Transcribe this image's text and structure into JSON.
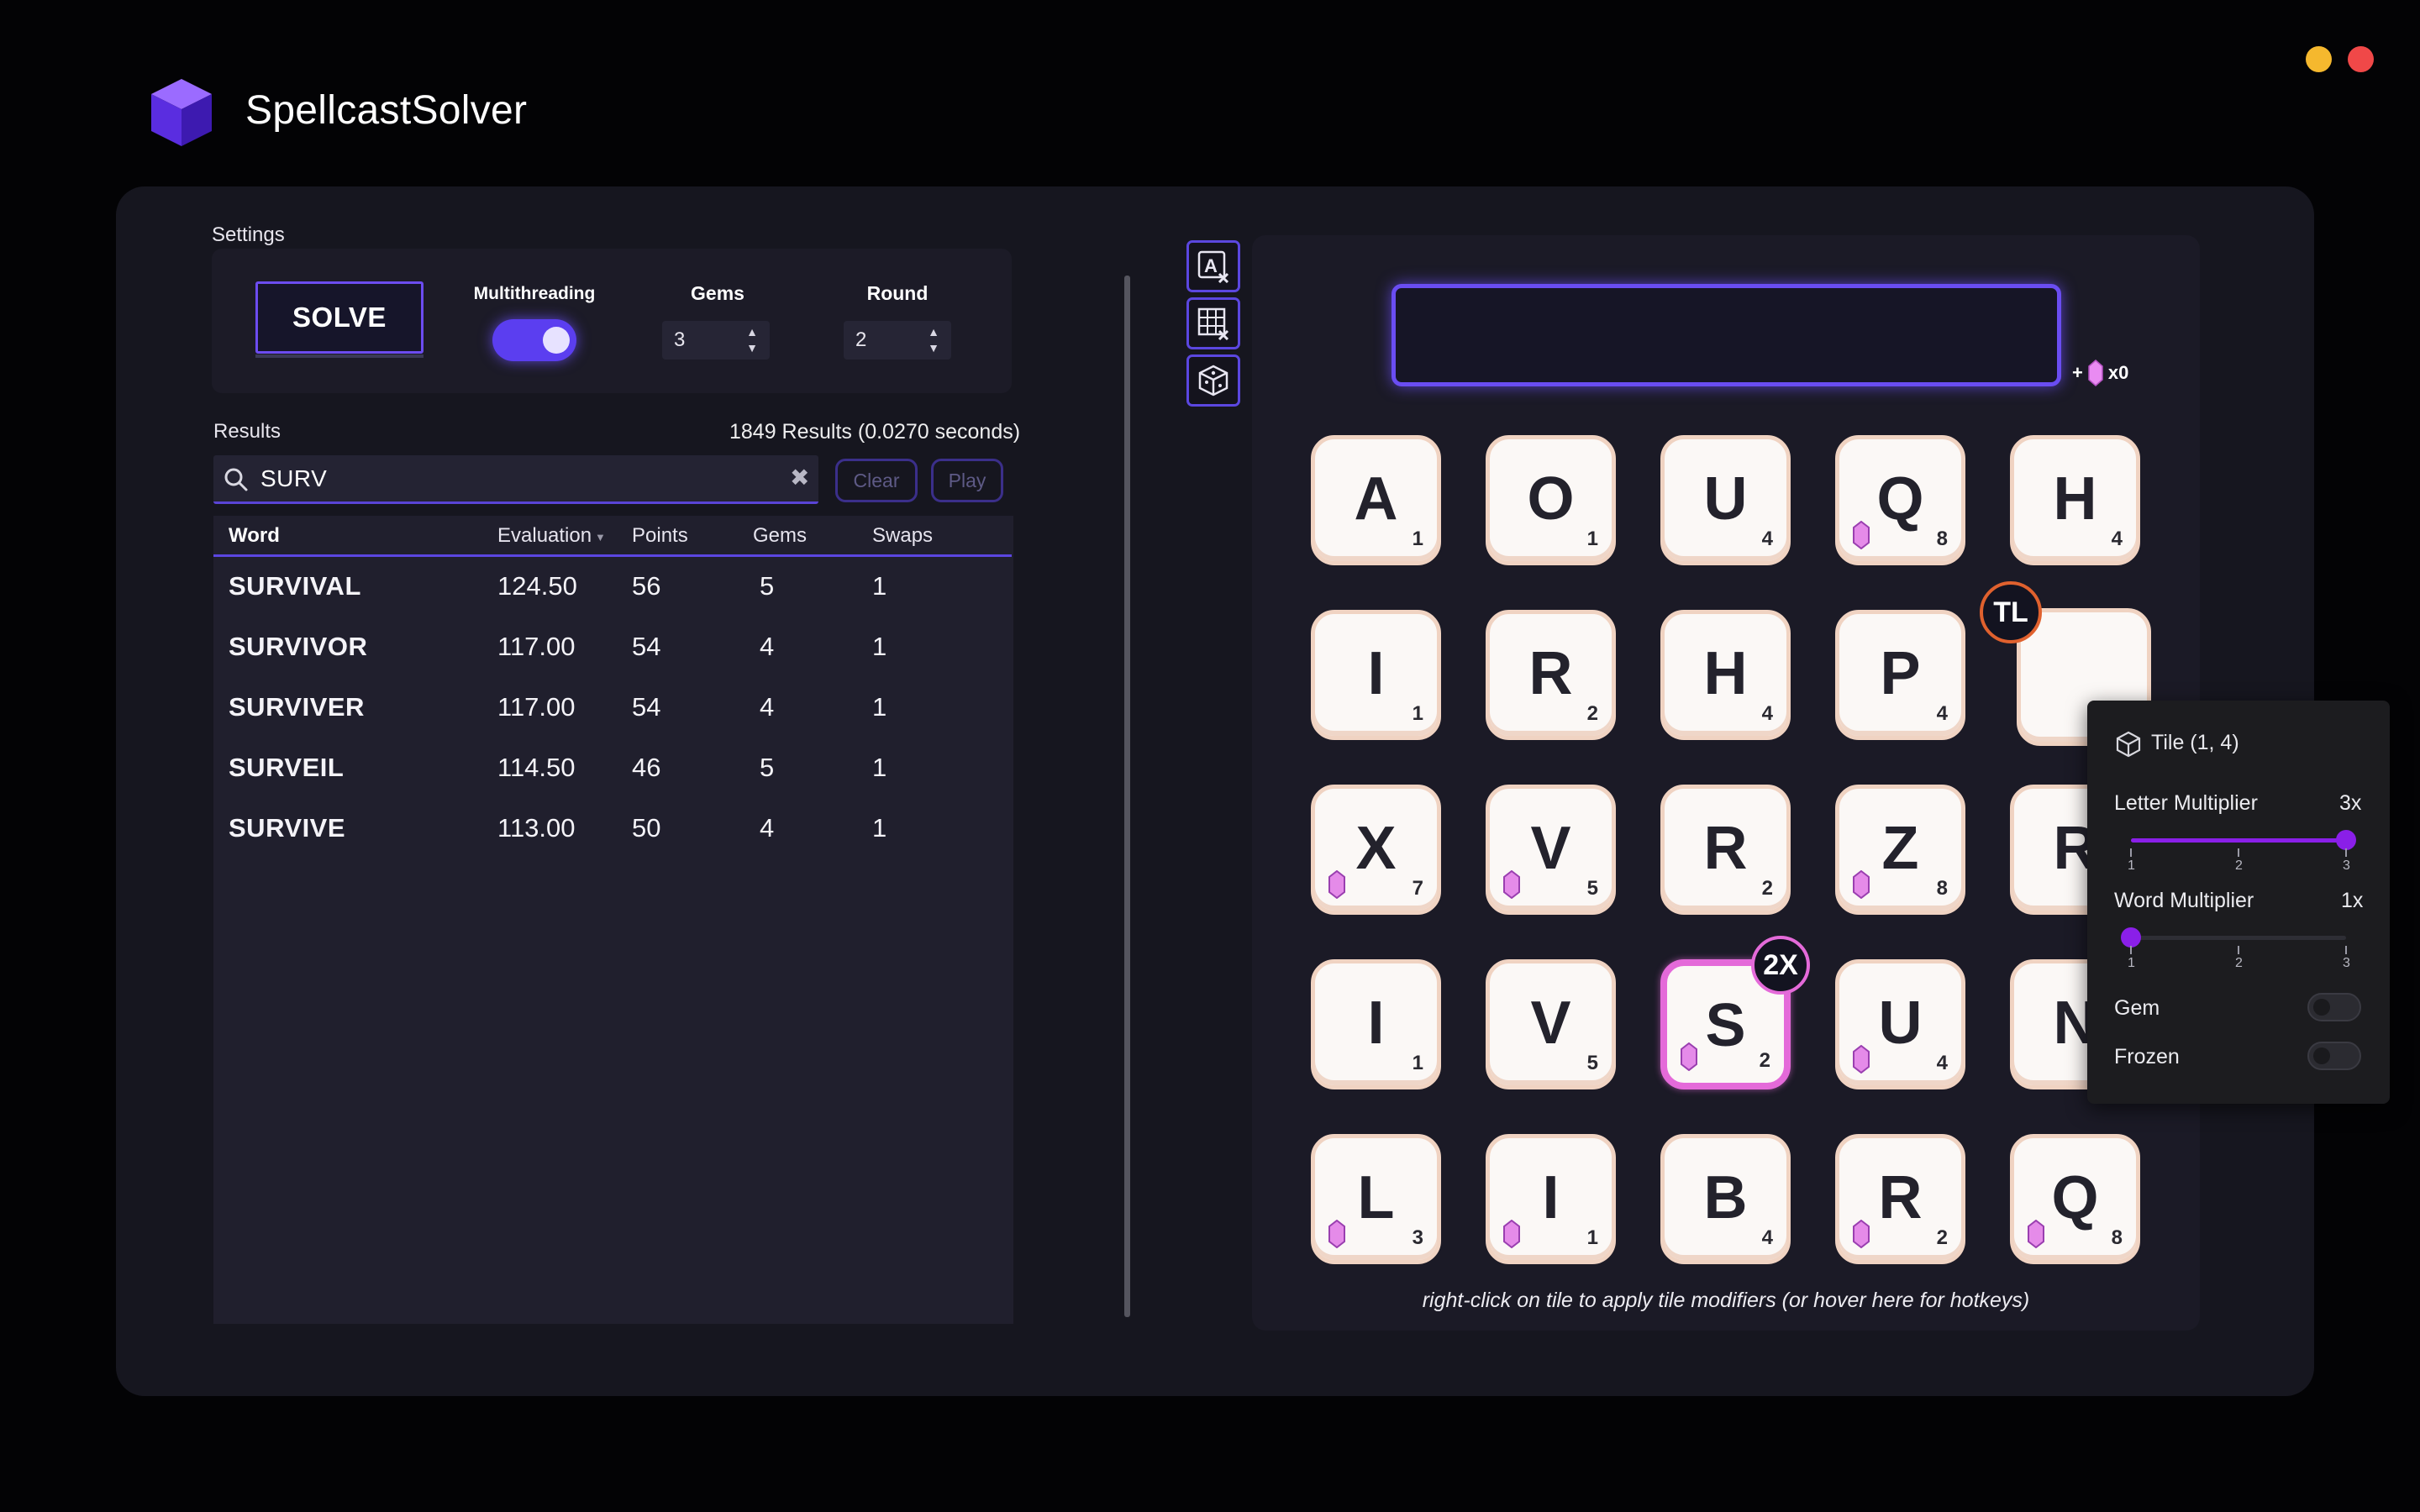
{
  "app": {
    "title": "SpellcastSolver"
  },
  "window_controls": [
    {
      "name": "minimize",
      "color": "#f5b82e"
    },
    {
      "name": "close",
      "color": "#f04848"
    }
  ],
  "settings": {
    "label": "Settings",
    "solve_label": "SOLVE",
    "multithreading_label": "Multithreading",
    "multithreading_on": true,
    "gems_label": "Gems",
    "gems_value": "3",
    "round_label": "Round",
    "round_value": "2"
  },
  "results": {
    "label": "Results",
    "count_text": "1849 Results (0.0270 seconds)",
    "search_value": "SURV",
    "clear_label": "Clear",
    "play_label": "Play",
    "columns": [
      "Word",
      "Evaluation",
      "Points",
      "Gems",
      "Swaps"
    ],
    "rows": [
      {
        "word": "SURVIVAL",
        "evaluation": "124.50",
        "points": "56",
        "gems": "5",
        "swaps": "1"
      },
      {
        "word": "SURVIVOR",
        "evaluation": "117.00",
        "points": "54",
        "gems": "4",
        "swaps": "1"
      },
      {
        "word": "SURVIVER",
        "evaluation": "117.00",
        "points": "54",
        "gems": "4",
        "swaps": "1"
      },
      {
        "word": "SURVEIL",
        "evaluation": "114.50",
        "points": "46",
        "gems": "5",
        "swaps": "1"
      },
      {
        "word": "SURVIVE",
        "evaluation": "113.00",
        "points": "50",
        "gems": "4",
        "swaps": "1"
      }
    ]
  },
  "toolbar_icons": [
    "clear-letters-icon",
    "clear-grid-icon",
    "dice-icon"
  ],
  "board": {
    "gem_count_text": "x0",
    "gem_prefix": "+",
    "tiles": [
      [
        {
          "l": "A",
          "p": "1",
          "gem": false
        },
        {
          "l": "O",
          "p": "1",
          "gem": false
        },
        {
          "l": "U",
          "p": "4",
          "gem": false
        },
        {
          "l": "Q",
          "p": "8",
          "gem": true
        },
        {
          "l": "H",
          "p": "4",
          "gem": false
        }
      ],
      [
        {
          "l": "I",
          "p": "1",
          "gem": false
        },
        {
          "l": "R",
          "p": "2",
          "gem": false
        },
        {
          "l": "H",
          "p": "4",
          "gem": false
        },
        {
          "l": "P",
          "p": "4",
          "gem": false
        },
        {
          "l": "",
          "p": "",
          "gem": false
        }
      ],
      [
        {
          "l": "X",
          "p": "7",
          "gem": true
        },
        {
          "l": "V",
          "p": "5",
          "gem": true
        },
        {
          "l": "R",
          "p": "2",
          "gem": false
        },
        {
          "l": "Z",
          "p": "8",
          "gem": true
        },
        {
          "l": "R",
          "p": "",
          "gem": false
        }
      ],
      [
        {
          "l": "I",
          "p": "1",
          "gem": false
        },
        {
          "l": "V",
          "p": "5",
          "gem": false
        },
        {
          "l": "S",
          "p": "2",
          "gem": true
        },
        {
          "l": "U",
          "p": "4",
          "gem": true
        },
        {
          "l": "N",
          "p": "",
          "gem": false
        }
      ],
      [
        {
          "l": "L",
          "p": "3",
          "gem": true
        },
        {
          "l": "I",
          "p": "1",
          "gem": true
        },
        {
          "l": "B",
          "p": "4",
          "gem": false
        },
        {
          "l": "R",
          "p": "2",
          "gem": true
        },
        {
          "l": "Q",
          "p": "8",
          "gem": true
        }
      ]
    ],
    "tl_badge": "TL",
    "dw_badge": "2X",
    "hint": "right-click on tile to apply tile modifiers (or hover here for hotkeys)"
  },
  "tile_popover": {
    "title": "Tile (1, 4)",
    "letter_multiplier_label": "Letter Multiplier",
    "letter_multiplier_value": "3x",
    "letter_multiplier_level": 3,
    "word_multiplier_label": "Word Multiplier",
    "word_multiplier_value": "1x",
    "word_multiplier_level": 1,
    "ticks": [
      "1",
      "2",
      "3"
    ],
    "gem_label": "Gem",
    "gem_on": false,
    "frozen_label": "Frozen",
    "frozen_on": false
  }
}
